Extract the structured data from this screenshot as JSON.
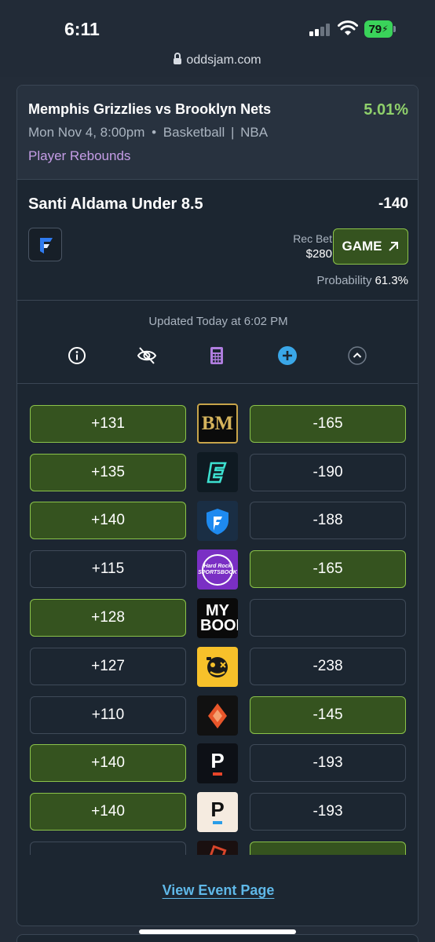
{
  "status": {
    "time": "6:11",
    "battery": "79"
  },
  "browser": {
    "url": "oddsjam.com"
  },
  "event": {
    "matchup": "Memphis Grizzlies vs Brooklyn Nets",
    "ev_percent": "5.01%",
    "datetime": "Mon Nov 4, 8:00pm",
    "sport": "Basketball",
    "league": "NBA",
    "market": "Player Rebounds"
  },
  "bet": {
    "selection": "Santi Aldama Under 8.5",
    "odds": "-140",
    "rec_bet_label": "Rec Bet",
    "rec_bet_amount": "$280",
    "game_button": "GAME",
    "probability_label": "Probability",
    "probability_value": "61.3%"
  },
  "tools": {
    "updated": "Updated Today at 6:02 PM",
    "icons": [
      "info-icon",
      "eye-off-icon",
      "calculator-icon",
      "plus-circle-icon",
      "chevron-up-icon"
    ]
  },
  "colors": {
    "accent_green": "#8fd06b",
    "highlight_bg": "#35531f",
    "highlight_border": "#8bc34a",
    "market_purple": "#c59de6",
    "link_blue": "#5fb8e8"
  },
  "odds_rows": [
    {
      "book": "BetMGM",
      "book_icon": "BM",
      "over": "+131",
      "over_hl": true,
      "under": "-165",
      "under_hl": true
    },
    {
      "book": "ESPN BET",
      "book_icon": "E",
      "over": "+135",
      "over_hl": true,
      "under": "-190",
      "under_hl": false
    },
    {
      "book": "FanDuel",
      "book_icon": "shield",
      "over": "+140",
      "over_hl": true,
      "under": "-188",
      "under_hl": false
    },
    {
      "book": "Hard Rock Sportsbook",
      "book_icon": "Hard Rock SPORTSBOOK",
      "over": "+115",
      "over_hl": false,
      "under": "-165",
      "under_hl": true
    },
    {
      "book": "MyBookie",
      "book_icon": "MY BOOKIE",
      "over": "+128",
      "over_hl": true,
      "under": "",
      "under_hl": false
    },
    {
      "book": "Underdog",
      "book_icon": "dog",
      "over": "+127",
      "over_hl": false,
      "under": "-238",
      "under_hl": false
    },
    {
      "book": "Fliff",
      "book_icon": "diamond",
      "over": "+110",
      "over_hl": false,
      "under": "-145",
      "under_hl": true
    },
    {
      "book": "PrizePicks",
      "book_icon": "P",
      "over": "+140",
      "over_hl": true,
      "under": "-193",
      "under_hl": false
    },
    {
      "book": "PrizePicks Light",
      "book_icon": "P",
      "over": "+140",
      "over_hl": true,
      "under": "-193",
      "under_hl": false
    },
    {
      "book": "Partial",
      "book_icon": "",
      "over": "",
      "over_hl": false,
      "under": "",
      "under_hl": true
    }
  ],
  "footer": {
    "view_event": "View Event Page"
  }
}
